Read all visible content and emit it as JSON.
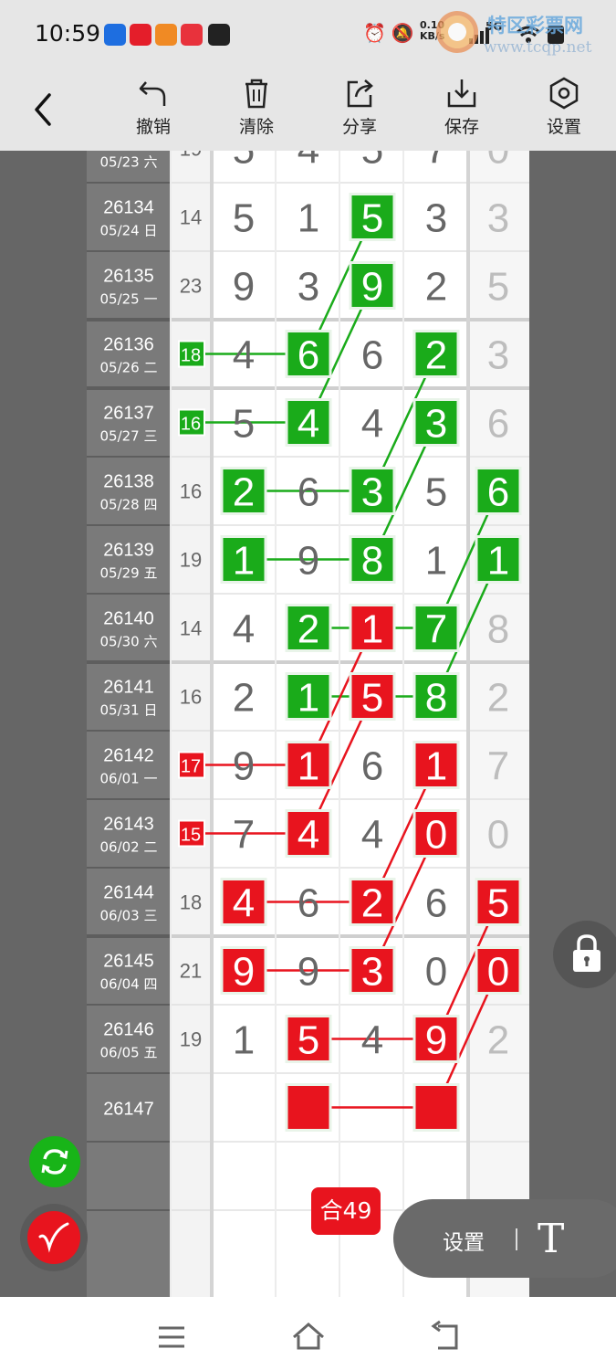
{
  "status_bar": {
    "time": "10:59",
    "net_speed_value": "0.10",
    "net_speed_unit": "KB/s",
    "network": "5G",
    "icons": [
      "alarm-icon",
      "mute-icon",
      "signal-icon",
      "wifi-icon",
      "battery-icon"
    ]
  },
  "watermark": {
    "title": "特区彩票网",
    "url": "www.tcqp.net"
  },
  "toolbar": {
    "back_icon": "chevron-left-icon",
    "items": [
      {
        "label": "撤销",
        "icon": "undo-icon"
      },
      {
        "label": "清除",
        "icon": "trash-icon"
      },
      {
        "label": "分享",
        "icon": "share-icon"
      },
      {
        "label": "保存",
        "icon": "download-icon"
      },
      {
        "label": "设置",
        "icon": "settings-icon"
      }
    ]
  },
  "chart_data": {
    "type": "table",
    "columns": [
      "period",
      "sum",
      "d1",
      "d2",
      "d3",
      "d4",
      "extra"
    ],
    "rows": [
      {
        "period": "",
        "date": "05/23 六",
        "sum": "19",
        "digits": [
          "5",
          "4",
          "5",
          "7"
        ],
        "extra": "0"
      },
      {
        "period": "26134",
        "date": "05/24 日",
        "sum": "14",
        "digits": [
          "5",
          "1",
          "5",
          "3"
        ],
        "extra": "3"
      },
      {
        "period": "26135",
        "date": "05/25 一",
        "sum": "23",
        "digits": [
          "9",
          "3",
          "9",
          "2"
        ],
        "extra": "5"
      },
      {
        "period": "26136",
        "date": "05/26 二",
        "sum": "18",
        "digits": [
          "4",
          "6",
          "6",
          "2"
        ],
        "extra": "3"
      },
      {
        "period": "26137",
        "date": "05/27 三",
        "sum": "16",
        "digits": [
          "5",
          "4",
          "4",
          "3"
        ],
        "extra": "6"
      },
      {
        "period": "26138",
        "date": "05/28 四",
        "sum": "16",
        "digits": [
          "2",
          "6",
          "3",
          "5"
        ],
        "extra": "6"
      },
      {
        "period": "26139",
        "date": "05/29 五",
        "sum": "19",
        "digits": [
          "1",
          "9",
          "8",
          "1"
        ],
        "extra": "1"
      },
      {
        "period": "26140",
        "date": "05/30 六",
        "sum": "14",
        "digits": [
          "4",
          "2",
          "1",
          "7"
        ],
        "extra": "8"
      },
      {
        "period": "26141",
        "date": "05/31 日",
        "sum": "16",
        "digits": [
          "2",
          "1",
          "5",
          "8"
        ],
        "extra": "2"
      },
      {
        "period": "26142",
        "date": "06/01 一",
        "sum": "17",
        "digits": [
          "9",
          "1",
          "6",
          "1"
        ],
        "extra": "7"
      },
      {
        "period": "26143",
        "date": "06/02 二",
        "sum": "15",
        "digits": [
          "7",
          "4",
          "4",
          "0"
        ],
        "extra": "0"
      },
      {
        "period": "26144",
        "date": "06/03 三",
        "sum": "18",
        "digits": [
          "4",
          "6",
          "2",
          "6"
        ],
        "extra": "5"
      },
      {
        "period": "26145",
        "date": "06/04 四",
        "sum": "21",
        "digits": [
          "9",
          "9",
          "3",
          "0"
        ],
        "extra": "0"
      },
      {
        "period": "26146",
        "date": "06/05 五",
        "sum": "19",
        "digits": [
          "1",
          "5",
          "4",
          "9"
        ],
        "extra": "2"
      },
      {
        "period": "26147",
        "date": "",
        "sum": "",
        "digits": [
          "",
          "",
          "",
          ""
        ],
        "extra": ""
      }
    ],
    "highlights": [
      {
        "row": 1,
        "col": 3,
        "color": "green"
      },
      {
        "row": 2,
        "col": 3,
        "color": "green"
      },
      {
        "row": 3,
        "col": 2,
        "color": "green"
      },
      {
        "row": 3,
        "col": 4,
        "color": "green"
      },
      {
        "row": 3,
        "col": 0,
        "color": "green",
        "sum_box": true
      },
      {
        "row": 4,
        "col": 2,
        "color": "green"
      },
      {
        "row": 4,
        "col": 4,
        "color": "green"
      },
      {
        "row": 4,
        "col": 0,
        "color": "green",
        "sum_box": true
      },
      {
        "row": 5,
        "col": 1,
        "color": "green"
      },
      {
        "row": 5,
        "col": 3,
        "color": "green"
      },
      {
        "row": 5,
        "col": 5,
        "color": "green"
      },
      {
        "row": 6,
        "col": 1,
        "color": "green"
      },
      {
        "row": 6,
        "col": 3,
        "color": "green"
      },
      {
        "row": 6,
        "col": 5,
        "color": "green"
      },
      {
        "row": 7,
        "col": 2,
        "color": "green"
      },
      {
        "row": 7,
        "col": 3,
        "color": "red"
      },
      {
        "row": 7,
        "col": 4,
        "color": "green"
      },
      {
        "row": 8,
        "col": 2,
        "color": "green"
      },
      {
        "row": 8,
        "col": 3,
        "color": "red"
      },
      {
        "row": 8,
        "col": 4,
        "color": "green"
      },
      {
        "row": 9,
        "col": 2,
        "color": "red"
      },
      {
        "row": 9,
        "col": 4,
        "color": "red"
      },
      {
        "row": 9,
        "col": 0,
        "color": "red",
        "sum_box": true
      },
      {
        "row": 10,
        "col": 2,
        "color": "red"
      },
      {
        "row": 10,
        "col": 4,
        "color": "red"
      },
      {
        "row": 10,
        "col": 0,
        "color": "red",
        "sum_box": true
      },
      {
        "row": 11,
        "col": 1,
        "color": "red"
      },
      {
        "row": 11,
        "col": 3,
        "color": "red"
      },
      {
        "row": 11,
        "col": 5,
        "color": "red"
      },
      {
        "row": 12,
        "col": 1,
        "color": "red"
      },
      {
        "row": 12,
        "col": 3,
        "color": "red"
      },
      {
        "row": 12,
        "col": 5,
        "color": "red"
      },
      {
        "row": 13,
        "col": 2,
        "color": "red"
      },
      {
        "row": 13,
        "col": 4,
        "color": "red"
      },
      {
        "row": 14,
        "col": 2,
        "color": "red"
      },
      {
        "row": 14,
        "col": 4,
        "color": "red"
      }
    ],
    "lines": [
      {
        "color": "green",
        "from": [
          1,
          3
        ],
        "to": [
          3,
          2
        ]
      },
      {
        "color": "green",
        "from": [
          2,
          3
        ],
        "to": [
          4,
          2
        ]
      },
      {
        "color": "green",
        "from": [
          3,
          0
        ],
        "to": [
          3,
          2
        ]
      },
      {
        "color": "green",
        "from": [
          4,
          0
        ],
        "to": [
          4,
          2
        ]
      },
      {
        "color": "green",
        "from": [
          3,
          4
        ],
        "to": [
          5,
          3
        ]
      },
      {
        "color": "green",
        "from": [
          4,
          4
        ],
        "to": [
          6,
          3
        ]
      },
      {
        "color": "green",
        "from": [
          5,
          1
        ],
        "to": [
          5,
          3
        ]
      },
      {
        "color": "green",
        "from": [
          6,
          1
        ],
        "to": [
          6,
          3
        ]
      },
      {
        "color": "green",
        "from": [
          5,
          5
        ],
        "to": [
          7,
          4
        ]
      },
      {
        "color": "green",
        "from": [
          6,
          5
        ],
        "to": [
          8,
          4
        ]
      },
      {
        "color": "green",
        "from": [
          7,
          2
        ],
        "to": [
          7,
          4
        ]
      },
      {
        "color": "green",
        "from": [
          8,
          2
        ],
        "to": [
          8,
          4
        ]
      },
      {
        "color": "red",
        "from": [
          7,
          3
        ],
        "to": [
          9,
          2
        ]
      },
      {
        "color": "red",
        "from": [
          8,
          3
        ],
        "to": [
          10,
          2
        ]
      },
      {
        "color": "red",
        "from": [
          9,
          0
        ],
        "to": [
          9,
          2
        ]
      },
      {
        "color": "red",
        "from": [
          10,
          0
        ],
        "to": [
          10,
          2
        ]
      },
      {
        "color": "red",
        "from": [
          9,
          4
        ],
        "to": [
          11,
          3
        ]
      },
      {
        "color": "red",
        "from": [
          10,
          4
        ],
        "to": [
          12,
          3
        ]
      },
      {
        "color": "red",
        "from": [
          11,
          1
        ],
        "to": [
          11,
          3
        ]
      },
      {
        "color": "red",
        "from": [
          12,
          1
        ],
        "to": [
          12,
          3
        ]
      },
      {
        "color": "red",
        "from": [
          11,
          5
        ],
        "to": [
          13,
          4
        ]
      },
      {
        "color": "red",
        "from": [
          12,
          5
        ],
        "to": [
          14,
          4
        ]
      },
      {
        "color": "red",
        "from": [
          13,
          2
        ],
        "to": [
          13,
          4
        ]
      },
      {
        "color": "red",
        "from": [
          14,
          2
        ],
        "to": [
          14,
          4
        ]
      }
    ],
    "colors": {
      "green": "#1aab1a",
      "red": "#e8141e",
      "digit_gray": "#666666",
      "extra_gray": "#bdbdbd",
      "period_bg": "#7a7a7a",
      "sum_bg": "#f3f3f3"
    }
  },
  "sum_badge": "合49",
  "floating": {
    "lock_icon": "lock-icon",
    "refresh_icon": "refresh-icon",
    "pen_icon": "pen-icon",
    "settings_label": "设置",
    "text_tool": "T"
  },
  "navbar": {
    "icons": [
      "menu-icon",
      "home-icon",
      "back-icon"
    ]
  }
}
